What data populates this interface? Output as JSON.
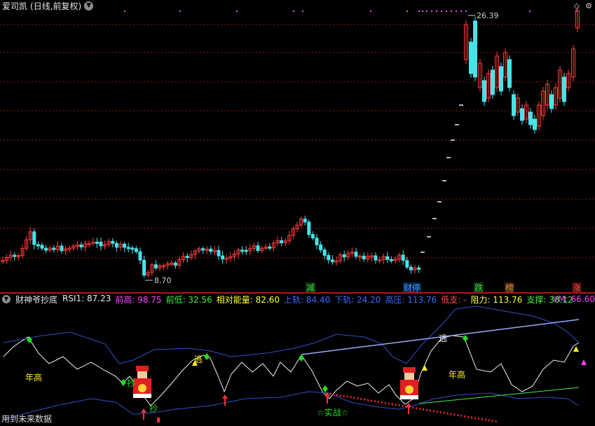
{
  "header": {
    "stock_name": "爱司凯",
    "period_info": "(日线,前复权)",
    "dropdown_icon": "chevron-down-icon",
    "corner_icons": [
      "diamond-icon",
      "gear-icon"
    ]
  },
  "price_labels": {
    "high": "26.39",
    "low": "8.70"
  },
  "tags": [
    "减",
    "财停",
    "跌",
    "榜",
    "涨"
  ],
  "indicator": {
    "name": "财神爷抄底",
    "items": [
      {
        "label": "RSI1:",
        "value": "87.23",
        "color": "#e8e8e8"
      },
      {
        "label": "前高:",
        "value": "98.75",
        "color": "#ff44ff"
      },
      {
        "label": "前低:",
        "value": "32.56",
        "color": "#44ee44"
      },
      {
        "label": "相对能量:",
        "value": "82.60",
        "color": "#ffff44"
      },
      {
        "label": "上轨:",
        "value": "84.40",
        "color": "#3a6cff"
      },
      {
        "label": "下轨:",
        "value": "24.20",
        "color": "#3a6cff"
      },
      {
        "label": "高压:",
        "value": "113.76",
        "color": "#3a6cff"
      },
      {
        "label": "低支:",
        "value": "-",
        "color": "#ff5050"
      },
      {
        "label": "阻力:",
        "value": "113.76",
        "color": "#ffff44"
      },
      {
        "label": "支撑:",
        "value": "38.12",
        "color": "#44ee44"
      }
    ],
    "vm": "VM: 66.60"
  },
  "annotations": {
    "year_high": "年高",
    "escape": "逃",
    "combat": "实战",
    "dip": "抄"
  },
  "footnote": "用到未来数据",
  "colors": {
    "up": "#ff3b3b",
    "down": "#44e4e8",
    "grid": "#a01010",
    "band": "#3050c8",
    "signal": "#ff3333"
  }
}
